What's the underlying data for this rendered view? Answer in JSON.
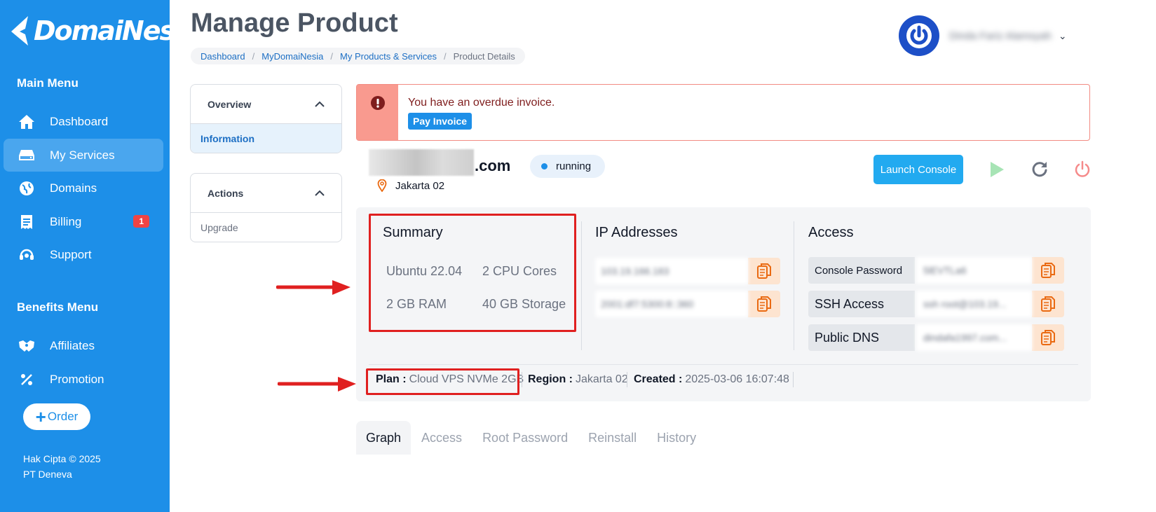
{
  "brand": {
    "logo_text": "DomaiNesia"
  },
  "sidebar": {
    "main_menu_title": "Main Menu",
    "items": [
      {
        "label": "Dashboard",
        "icon": "home-icon"
      },
      {
        "label": "My Services",
        "icon": "server-icon",
        "active": true
      },
      {
        "label": "Domains",
        "icon": "globe-icon"
      },
      {
        "label": "Billing",
        "icon": "receipt-icon",
        "badge": "1"
      },
      {
        "label": "Support",
        "icon": "headset-icon"
      }
    ],
    "benefits_menu_title": "Benefits Menu",
    "benefits": [
      {
        "label": "Affiliates",
        "icon": "handshake-icon"
      },
      {
        "label": "Promotion",
        "icon": "percent-icon"
      }
    ],
    "order_label": "Order",
    "copyright_line1": "Hak Cipta © 2025",
    "copyright_line2": "PT Deneva"
  },
  "header": {
    "title": "Manage Product",
    "breadcrumb": [
      "Dashboard",
      "MyDomaiNesia",
      "My Products & Services",
      "Product Details"
    ],
    "user_name": "Dinda Fariz Alamsyah"
  },
  "overview_panel": {
    "title": "Overview",
    "items": [
      "Information"
    ]
  },
  "actions_panel": {
    "title": "Actions",
    "items": [
      "Upgrade"
    ]
  },
  "alert": {
    "message": "You have an overdue invoice.",
    "button": "Pay Invoice"
  },
  "server": {
    "domain_suffix": ".com",
    "status": "running",
    "location": "Jakarta 02",
    "launch_console": "Launch Console"
  },
  "summary": {
    "title": "Summary",
    "os": "Ubuntu 22.04",
    "cpu": "2 CPU Cores",
    "ram": "2 GB RAM",
    "storage": "40 GB Storage"
  },
  "ip_addresses": {
    "title": "IP Addresses",
    "ipv4": "103.19.166.183",
    "ipv6": "2001:df7:5300:8::360"
  },
  "access": {
    "title": "Access",
    "rows": [
      {
        "label": "Console Password",
        "value": "5lEVTLa6"
      },
      {
        "label": "SSH Access",
        "value": "ssh root@103.19..."
      },
      {
        "label": "Public DNS",
        "value": "dindafa1997.com..."
      }
    ]
  },
  "meta": {
    "plan_label": "Plan :",
    "plan": "Cloud VPS NVMe 2GB",
    "region_label": "Region :",
    "region": "Jakarta 02",
    "created_label": "Created :",
    "created": "2025-03-06 16:07:48"
  },
  "tabs": [
    "Graph",
    "Access",
    "Root Password",
    "Reinstall",
    "History"
  ],
  "colors": {
    "sidebar": "#1d8fe8",
    "accent": "#22aaf0",
    "alert_bg": "#f99a8f",
    "copy_icon": "#ea6a12",
    "annotation": "#e02020"
  }
}
